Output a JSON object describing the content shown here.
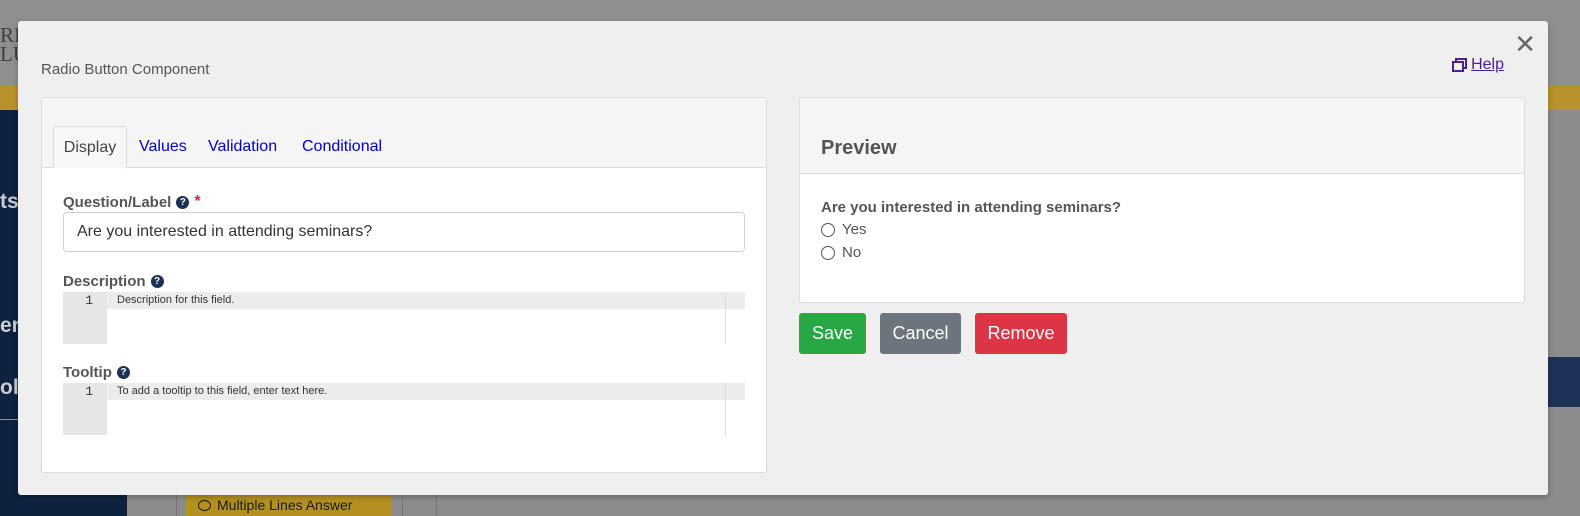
{
  "background": {
    "logo_line1": "RIT",
    "logo_line2": "LU",
    "sidebar_fragments": [
      "ts",
      "en",
      "ol"
    ],
    "chip_label": "Multiple Lines Answer"
  },
  "modal": {
    "title": "Radio Button Component",
    "close_icon": "close-icon",
    "help_label": "Help",
    "help_icon": "external-window-icon"
  },
  "tabs": [
    "Display",
    "Values",
    "Validation",
    "Conditional"
  ],
  "active_tab": "Display",
  "fields": {
    "question_label": {
      "label": "Question/Label",
      "required_mark": "*",
      "value": "Are you interested in attending seminars?"
    },
    "description": {
      "label": "Description",
      "line_number": "1",
      "placeholder": "Description for this field."
    },
    "tooltip": {
      "label": "Tooltip",
      "line_number": "1",
      "placeholder": "To add a tooltip to this field, enter text here."
    },
    "help_icon_glyph": "?"
  },
  "preview": {
    "title": "Preview",
    "question": "Are you interested in attending seminars?",
    "options": [
      "Yes",
      "No"
    ]
  },
  "actions": {
    "save": "Save",
    "cancel": "Cancel",
    "remove": "Remove"
  },
  "colors": {
    "save": "#28a745",
    "cancel": "#6c757d",
    "remove": "#dc3545",
    "link": "#0000cc",
    "required": "#d9263a"
  }
}
